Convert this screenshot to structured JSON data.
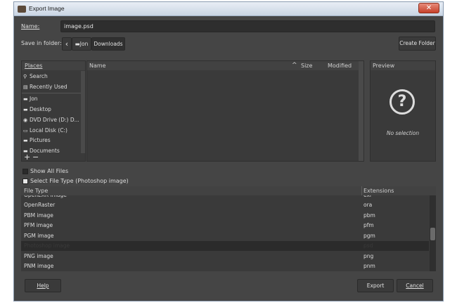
{
  "window": {
    "title": "Export Image",
    "close_glyph": "✕"
  },
  "name_field": {
    "label": "Name:",
    "value": "image.psd"
  },
  "folder": {
    "label": "Save in folder:",
    "back_glyph": "‹",
    "crumbs": [
      "Jon",
      "Downloads"
    ],
    "create_folder": "Create Folder"
  },
  "places": {
    "header": "Places",
    "items": [
      {
        "label": "Search",
        "icon": "search-icon",
        "glyph": "🔍"
      },
      {
        "label": "Recently Used",
        "icon": "recent-icon",
        "glyph": "🕓"
      },
      {
        "label": "Jon",
        "icon": "folder-icon",
        "glyph": "▬"
      },
      {
        "label": "Desktop",
        "icon": "folder-icon",
        "glyph": "▬"
      },
      {
        "label": "DVD Drive (D:) D...",
        "icon": "disc-icon",
        "glyph": "◉"
      },
      {
        "label": "Local Disk (C:)",
        "icon": "drive-icon",
        "glyph": "▭"
      },
      {
        "label": "Pictures",
        "icon": "folder-icon",
        "glyph": "▬"
      },
      {
        "label": "Documents",
        "icon": "folder-icon",
        "glyph": "▬"
      }
    ],
    "add_glyph": "+",
    "remove_glyph": "−"
  },
  "files": {
    "col_name": "Name",
    "col_size": "Size",
    "col_modified": "Modified",
    "sort_glyph": "^"
  },
  "preview": {
    "header": "Preview",
    "icon": "question-icon",
    "glyph": "?",
    "empty_text": "No selection"
  },
  "show_all": {
    "label": "Show All Files"
  },
  "file_type": {
    "expander": "Select File Type (Photoshop image)",
    "col_type": "File Type",
    "col_ext": "Extensions",
    "rows": [
      {
        "type": "OpenEXR image",
        "ext": "exr"
      },
      {
        "type": "OpenRaster",
        "ext": "ora"
      },
      {
        "type": "PBM image",
        "ext": "pbm"
      },
      {
        "type": "PFM image",
        "ext": "pfm"
      },
      {
        "type": "PGM image",
        "ext": "pgm"
      },
      {
        "type": "Photoshop image",
        "ext": "psd",
        "selected": true
      },
      {
        "type": "PNG image",
        "ext": "png"
      },
      {
        "type": "PNM image",
        "ext": "pnm"
      }
    ]
  },
  "buttons": {
    "help": "Help",
    "export": "Export",
    "cancel": "Cancel"
  },
  "colors": {
    "bg": "#454545",
    "pane": "#3a3a3a",
    "field": "#2e2e2e",
    "text": "#dcdcdc",
    "selected_row": "#2b2b2b"
  }
}
